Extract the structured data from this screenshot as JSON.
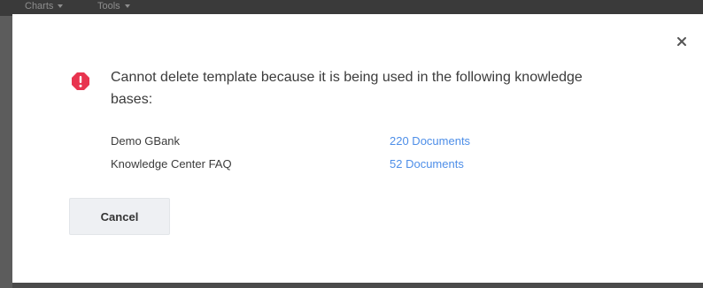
{
  "background": {
    "menus": [
      {
        "label": "Charts"
      },
      {
        "label": "Tools"
      }
    ]
  },
  "dialog": {
    "message": "Cannot delete template because it is being used in the following knowledge bases:",
    "knowledge_bases": [
      {
        "name": "Demo GBank",
        "documents": "220 Documents"
      },
      {
        "name": "Knowledge Center FAQ",
        "documents": "52 Documents"
      }
    ],
    "cancel_label": "Cancel",
    "close_icon": "close-icon",
    "alert_icon": "alert-icon"
  },
  "colors": {
    "alert": "#e8344f",
    "link": "#4d8ee8",
    "text": "#3b3b3b",
    "button_bg": "#eef0f3"
  }
}
